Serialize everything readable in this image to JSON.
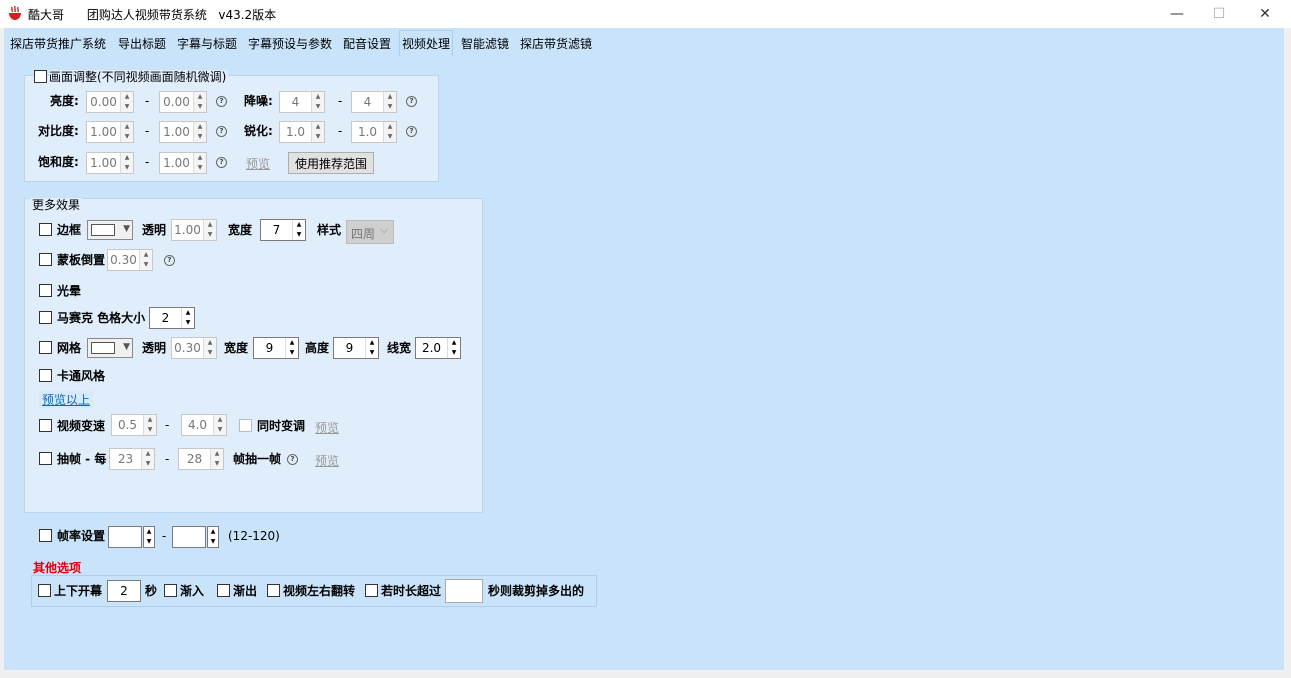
{
  "window": {
    "app_name": "酷大哥",
    "title": "团购达人视频带货系统   v43.2版本",
    "minimize": "—",
    "maximize": "☐",
    "close": "✕"
  },
  "tabs": [
    {
      "label": "探店带货推广系统"
    },
    {
      "label": "导出标题"
    },
    {
      "label": "字幕与标题"
    },
    {
      "label": "字幕预设与参数"
    },
    {
      "label": "配音设置"
    },
    {
      "label": "视频处理"
    },
    {
      "label": "智能滤镜"
    },
    {
      "label": "探店带货滤镜"
    }
  ],
  "active_tab": "视频处理",
  "picture_adjust": {
    "header": "画面调整(不同视频画面随机微调)",
    "brightness": {
      "label": "亮度:",
      "min": "0.00",
      "max": "0.00"
    },
    "contrast": {
      "label": "对比度:",
      "min": "1.00",
      "max": "1.00"
    },
    "saturation": {
      "label": "饱和度:",
      "min": "1.00",
      "max": "1.00"
    },
    "denoise": {
      "label": "降噪:",
      "min": "4",
      "max": "4"
    },
    "sharpen": {
      "label": "锐化:",
      "min": "1.0",
      "max": "1.0"
    },
    "dash": "-",
    "preview": "预览",
    "use_recommended": "使用推荐范围"
  },
  "more_effects": {
    "title": "更多效果",
    "border": {
      "label": "边框",
      "opacity_label": "透明",
      "opacity": "1.00",
      "width_label": "宽度",
      "width": "7",
      "style_label": "样式",
      "style": "四周"
    },
    "mask_reflection": {
      "label": "蒙板倒置",
      "value": "0.30"
    },
    "halo": {
      "label": "光晕"
    },
    "mosaic": {
      "label": "马赛克 色格大小",
      "value": "2"
    },
    "grid": {
      "label": "网格",
      "opacity_label": "透明",
      "opacity": "0.30",
      "width_label": "宽度",
      "width": "9",
      "height_label": "高度",
      "height": "9",
      "line_label": "线宽",
      "line": "2.0"
    },
    "cartoon": {
      "label": "卡通风格"
    },
    "preview_above": "预览以上",
    "speed": {
      "label": "视频变速",
      "min": "0.5",
      "max": "4.0",
      "pitch_label": "同时变调",
      "preview": "预览"
    },
    "frame_drop": {
      "label": "抽帧 - 每",
      "min": "23",
      "max": "28",
      "suffix": "帧抽一帧",
      "preview": "预览"
    }
  },
  "frame_rate": {
    "label": "帧率设置",
    "min": "",
    "max": "",
    "range_hint": "(12-120)"
  },
  "other_options": {
    "title": "其他选项",
    "curtain": {
      "label": "上下开幕",
      "value": "2",
      "unit": "秒"
    },
    "fade_in": "渐入",
    "fade_out": "渐出",
    "flip": "视频左右翻转",
    "trim": {
      "label": "若时长超过",
      "value": "",
      "suffix": "秒则裁剪掉多出的"
    }
  },
  "colors": {
    "panel_bg": "#c9e3fb",
    "group_bg": "#e0eefb",
    "title_red": "#e00000",
    "link_blue": "#0a66c2"
  },
  "icons": [
    "app-logo-icon",
    "help-icon",
    "spin-up-icon",
    "spin-down-icon",
    "dropdown-caret-icon"
  ]
}
